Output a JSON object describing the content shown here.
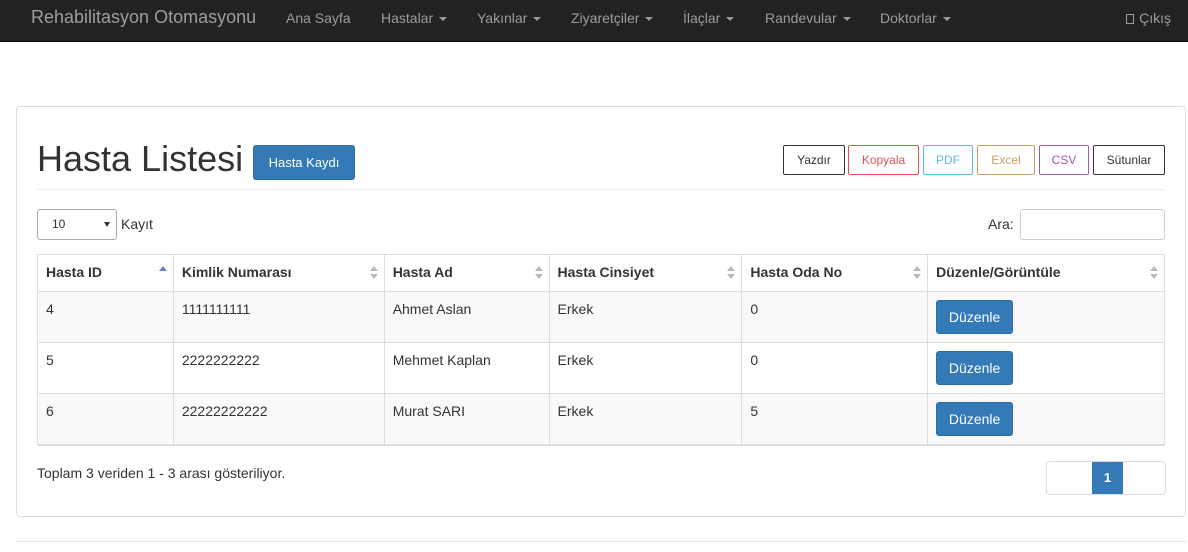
{
  "navbar": {
    "brand": "Rehabilitasyon Otomasyonu",
    "items": [
      {
        "label": "Ana Sayfa"
      },
      {
        "label": "Hastalar"
      },
      {
        "label": "Yakınlar"
      },
      {
        "label": "Ziyaretçiler"
      },
      {
        "label": "İlaçlar"
      },
      {
        "label": "Randevular"
      },
      {
        "label": "Doktorlar"
      }
    ],
    "logout_label": "Çıkış"
  },
  "page": {
    "title": "Hasta Listesi",
    "add_button": "Hasta Kaydı"
  },
  "export_buttons": [
    {
      "label": "Yazdır",
      "color": "#333333"
    },
    {
      "label": "Kopyala",
      "color": "#d9534f"
    },
    {
      "label": "PDF",
      "color": "#5bc0de"
    },
    {
      "label": "Excel",
      "color": "#c8a060"
    },
    {
      "label": "CSV",
      "color": "#9b59b6"
    },
    {
      "label": "Sütunlar",
      "color": "#333333"
    }
  ],
  "controls": {
    "page_length": "10",
    "page_length_label": "Kayıt",
    "search_label": "Ara:",
    "search_value": ""
  },
  "table": {
    "headers": [
      "Hasta ID",
      "Kimlik Numarası",
      "Hasta Ad",
      "Hasta Cinsiyet",
      "Hasta Oda No",
      "Düzenle/Görüntüle"
    ],
    "rows": [
      {
        "id": "4",
        "kimlik": "1111111111",
        "ad": "Ahmet Aslan",
        "cinsiyet": "Erkek",
        "oda": "0",
        "action": "Düzenle"
      },
      {
        "id": "5",
        "kimlik": "2222222222",
        "ad": "Mehmet Kaplan",
        "cinsiyet": "Erkek",
        "oda": "0",
        "action": "Düzenle"
      },
      {
        "id": "6",
        "kimlik": "22222222222",
        "ad": "Murat SARI",
        "cinsiyet": "Erkek",
        "oda": "5",
        "action": "Düzenle"
      }
    ]
  },
  "footer": {
    "info": "Toplam 3 veriden 1 - 3 arası gösteriliyor.",
    "current_page": "1"
  },
  "colors": {
    "primary": "#337ab7",
    "navbar_bg": "#222222"
  }
}
